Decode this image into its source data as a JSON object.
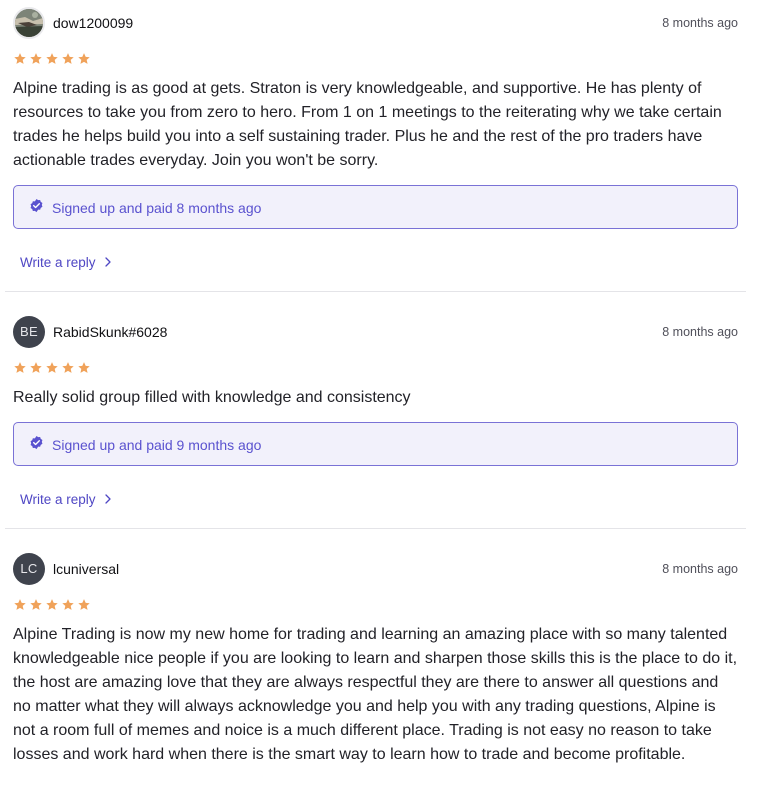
{
  "reviews": [
    {
      "author": "dow1200099",
      "avatar_initials": "",
      "time": "8 months ago",
      "rating": 5,
      "text": "Alpine trading is as good at gets. Straton is very knowledgeable, and supportive. He has plenty of resources to take you from zero to hero. From 1 on 1 meetings to the reiterating why we take certain trades he helps build you into a self sustaining trader. Plus he and the rest of the pro traders have actionable trades everyday. Join you won't be sorry.",
      "badge": "Signed up and paid 8 months ago",
      "reply_label": "Write a reply"
    },
    {
      "author": "RabidSkunk#6028",
      "avatar_initials": "BE",
      "time": "8 months ago",
      "rating": 5,
      "text": "Really solid group filled with knowledge and consistency",
      "badge": "Signed up and paid 9 months ago",
      "reply_label": "Write a reply"
    },
    {
      "author": "lcuniversal",
      "avatar_initials": "LC",
      "time": "8 months ago",
      "rating": 5,
      "text": "Alpine Trading is now my new home for trading and learning an amazing place with so many talented knowledgeable nice people if you are looking to learn and sharpen those skills this is the place to do it, the host are amazing love that they are always respectful they are there to answer all questions and no matter what they will always acknowledge you and help you with any trading questions, Alpine is not a room full of memes and noice is a much different place. Trading is not easy no reason to take losses and work hard when there is the smart way to learn how to trade and become profitable."
    }
  ],
  "colors": {
    "star": "#f0a25a",
    "accent": "#5a52cf",
    "badge_bg": "#f2f1fb",
    "badge_border": "#7a72d6"
  },
  "icons": {
    "rating": "star-icon",
    "verified": "verified-check-icon",
    "reply": "chevron-right-icon"
  }
}
